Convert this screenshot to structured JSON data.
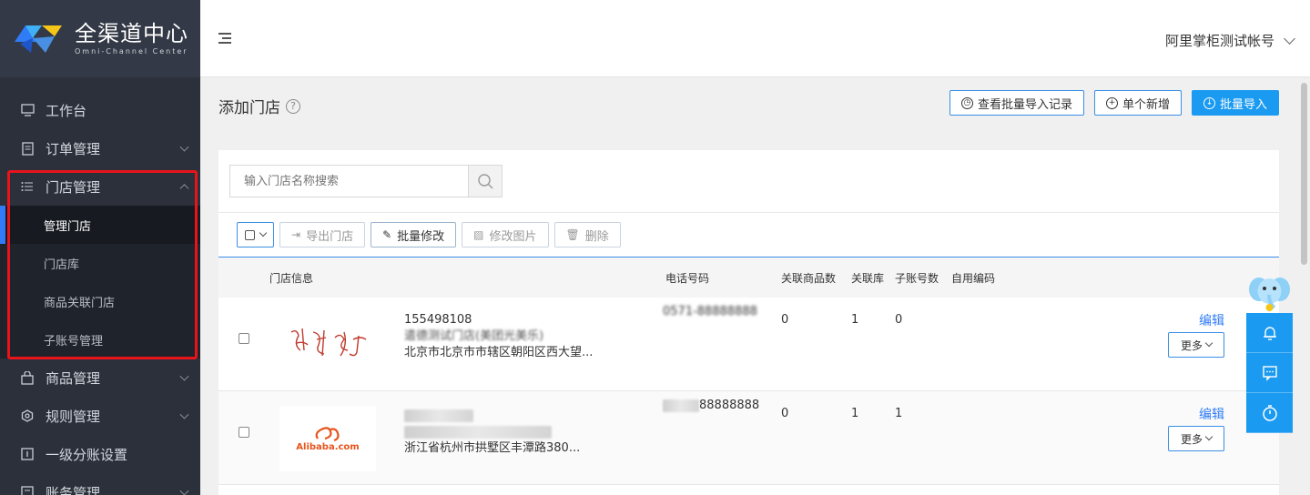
{
  "brand": {
    "title": "全渠道中心",
    "subtitle": "Omni-Channel Center"
  },
  "sidebar": {
    "items": [
      {
        "label": "工作台",
        "icon": "monitor-icon"
      },
      {
        "label": "订单管理",
        "icon": "document-icon"
      },
      {
        "label": "门店管理",
        "icon": "list-icon",
        "expanded": true,
        "children": [
          "管理门店",
          "门店库",
          "商品关联门店",
          "子账号管理"
        ],
        "active_child": "管理门店"
      },
      {
        "label": "商品管理",
        "icon": "bag-icon"
      },
      {
        "label": "规则管理",
        "icon": "settings-icon"
      },
      {
        "label": "一级分账设置",
        "icon": "account-icon"
      },
      {
        "label": "账务管理",
        "icon": "ledger-icon"
      }
    ]
  },
  "header": {
    "account": "阿里掌柜测试帐号"
  },
  "page": {
    "title": "添加门店",
    "buttons": {
      "history": "查看批量导入记录",
      "single_add": "单个新增",
      "batch_import": "批量导入"
    }
  },
  "search": {
    "placeholder": "输入门店名称搜索"
  },
  "toolbar": {
    "export": "导出门店",
    "batch_edit": "批量修改",
    "edit_image": "修改图片",
    "delete": "删除"
  },
  "table": {
    "columns": [
      "门店信息",
      "电话号码",
      "关联商品数",
      "关联库",
      "子账号数",
      "自用编码"
    ],
    "rows": [
      {
        "id": "155498108",
        "name": "遣德测试门店(美团光美乐)",
        "address": "北京市北京市市辖区朝阳区西大望...",
        "phone": "0571-88888888",
        "goods": "0",
        "stock": "1",
        "subaccounts": "0",
        "edit": "编辑",
        "more": "更多"
      },
      {
        "id": "",
        "name": "",
        "address": "浙江省杭州市拱墅区丰潭路380...",
        "phone": "88888888",
        "goods": "0",
        "stock": "1",
        "subaccounts": "1",
        "edit": "编辑",
        "more": "更多",
        "logo_text": "Alibaba.com"
      }
    ]
  },
  "colors": {
    "accent": "#1a9af0",
    "sidebar_bg": "#2b303b",
    "highlight": "#e8141c",
    "link": "#2f7cf6"
  }
}
